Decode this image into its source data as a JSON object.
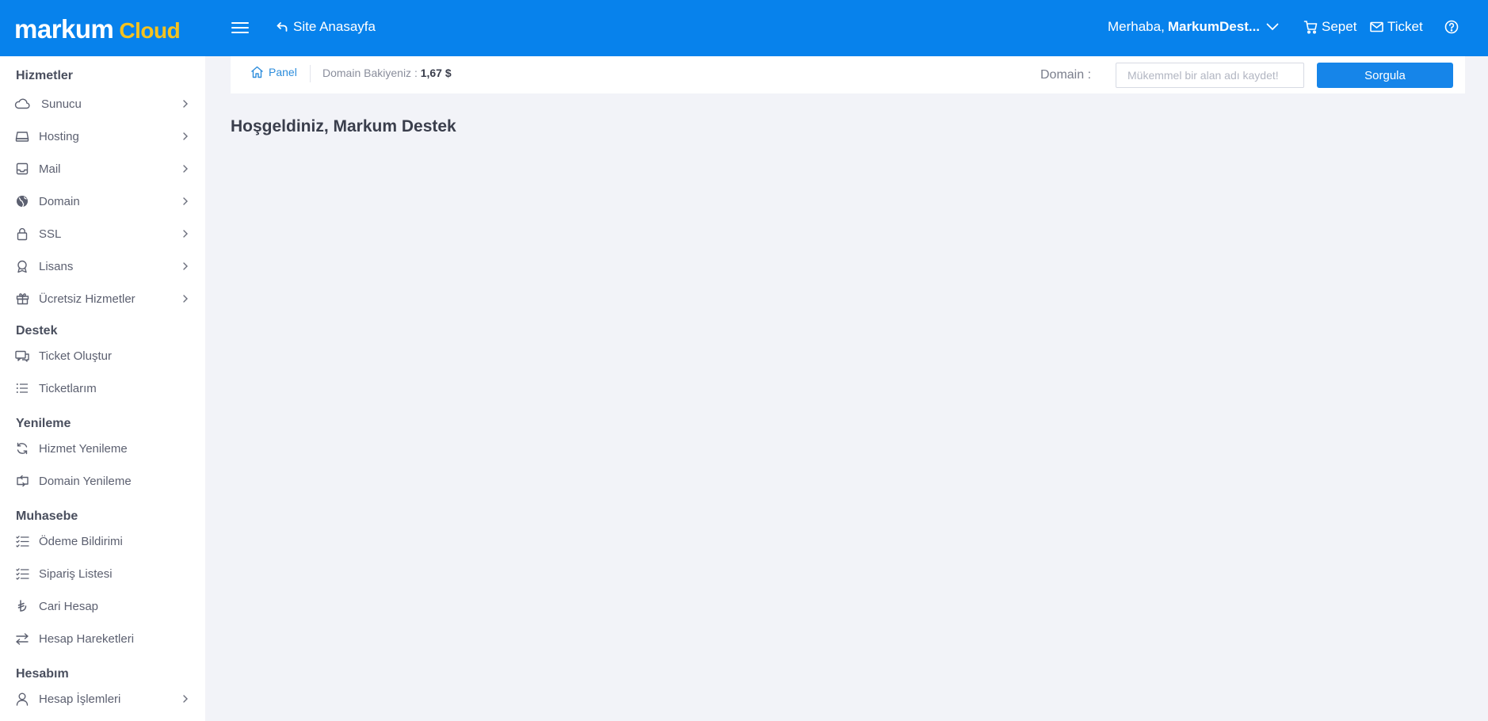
{
  "brand": {
    "name_part1": "markum",
    "name_part2": "Cloud",
    "color_primary": "#0782ec",
    "color_accent": "#f4c21f"
  },
  "topbar": {
    "menu_icon": "hamburger-icon",
    "site_home_label": "Site Anasayfa",
    "greeting_prefix": "Merhaba,",
    "greeting_user": "MarkumDest...",
    "cart_label": "Sepet",
    "ticket_label": "Ticket",
    "help_icon": "help-circle-icon"
  },
  "sidebar": {
    "sections": [
      {
        "title": "Hizmetler"
      },
      {
        "title": "Destek"
      },
      {
        "title": "Yenileme"
      },
      {
        "title": "Muhasebe"
      },
      {
        "title": "Hesabım"
      }
    ],
    "items": [
      {
        "label": "Sunucu",
        "icon": "cloud-icon"
      },
      {
        "label": "Hosting",
        "icon": "server-icon"
      },
      {
        "label": "Mail",
        "icon": "inbox-icon"
      },
      {
        "label": "Domain",
        "icon": "globe-icon"
      },
      {
        "label": "SSL",
        "icon": "lock-icon"
      },
      {
        "label": "Lisans",
        "icon": "award-icon"
      },
      {
        "label": "Ücretsiz Hizmetler",
        "icon": "gift-icon"
      },
      {
        "label": "Ticket Oluştur",
        "icon": "chat-icon"
      },
      {
        "label": "Ticketlarım",
        "icon": "list-icon"
      },
      {
        "label": "Hizmet Yenileme",
        "icon": "refresh-icon"
      },
      {
        "label": "Domain Yenileme",
        "icon": "repeat-icon"
      },
      {
        "label": "Ödeme Bildirimi",
        "icon": "checklist-icon"
      },
      {
        "label": "Sipariş Listesi",
        "icon": "checklist-icon"
      },
      {
        "label": "Cari Hesap",
        "icon": "lira-icon"
      },
      {
        "label": "Hesap Hareketleri",
        "icon": "swap-icon"
      },
      {
        "label": "Hesap İşlemleri",
        "icon": "user-icon"
      }
    ]
  },
  "toolbar": {
    "breadcrumb": "Panel",
    "balance_label": "Domain Bakiyeniz :",
    "balance_value": "1,67 $",
    "domain_label": "Domain :",
    "domain_placeholder": "Mükemmel bir alan adı kaydet!",
    "query_button": "Sorgula"
  },
  "main": {
    "welcome": "Hoşgeldiniz, Markum Destek"
  }
}
